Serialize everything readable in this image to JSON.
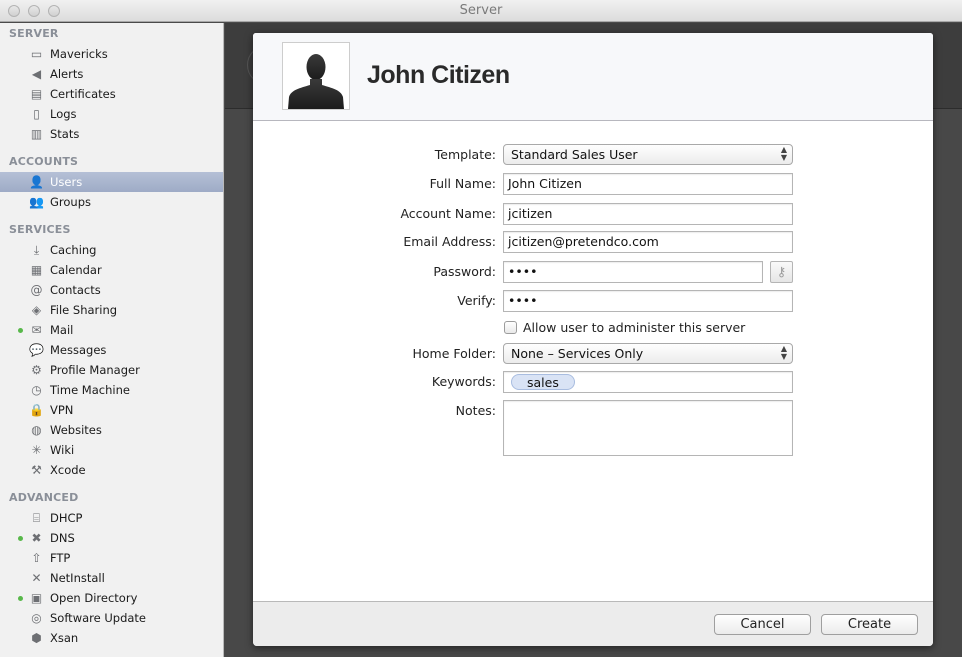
{
  "window": {
    "title": "Server"
  },
  "sidebar": {
    "sections": [
      {
        "header": "SERVER",
        "items": [
          {
            "label": "Mavericks",
            "icon": "monitor-icon",
            "glyph": "▭"
          },
          {
            "label": "Alerts",
            "icon": "megaphone-icon",
            "glyph": "◀"
          },
          {
            "label": "Certificates",
            "icon": "certificate-icon",
            "glyph": "▤"
          },
          {
            "label": "Logs",
            "icon": "document-icon",
            "glyph": "▯"
          },
          {
            "label": "Stats",
            "icon": "bar-chart-icon",
            "glyph": "▥"
          }
        ]
      },
      {
        "header": "ACCOUNTS",
        "items": [
          {
            "label": "Users",
            "icon": "user-icon",
            "glyph": "👤",
            "selected": true
          },
          {
            "label": "Groups",
            "icon": "group-icon",
            "glyph": "👥"
          }
        ]
      },
      {
        "header": "SERVICES",
        "items": [
          {
            "label": "Caching",
            "icon": "caching-icon",
            "glyph": "⤓"
          },
          {
            "label": "Calendar",
            "icon": "calendar-icon",
            "glyph": "▦"
          },
          {
            "label": "Contacts",
            "icon": "contacts-icon",
            "glyph": "@"
          },
          {
            "label": "File Sharing",
            "icon": "file-sharing-icon",
            "glyph": "◈"
          },
          {
            "label": "Mail",
            "icon": "mail-icon",
            "glyph": "✉",
            "status": "on"
          },
          {
            "label": "Messages",
            "icon": "messages-icon",
            "glyph": "💬"
          },
          {
            "label": "Profile Manager",
            "icon": "profile-manager-icon",
            "glyph": "⚙"
          },
          {
            "label": "Time Machine",
            "icon": "time-machine-icon",
            "glyph": "◷"
          },
          {
            "label": "VPN",
            "icon": "lock-icon",
            "glyph": "🔒"
          },
          {
            "label": "Websites",
            "icon": "globe-icon",
            "glyph": "◍"
          },
          {
            "label": "Wiki",
            "icon": "wiki-icon",
            "glyph": "✳"
          },
          {
            "label": "Xcode",
            "icon": "hammer-icon",
            "glyph": "⚒"
          }
        ]
      },
      {
        "header": "ADVANCED",
        "items": [
          {
            "label": "DHCP",
            "icon": "dhcp-icon",
            "glyph": "⌸"
          },
          {
            "label": "DNS",
            "icon": "dns-icon",
            "glyph": "✖",
            "status": "on"
          },
          {
            "label": "FTP",
            "icon": "ftp-icon",
            "glyph": "⇧"
          },
          {
            "label": "NetInstall",
            "icon": "netinstall-icon",
            "glyph": "✕"
          },
          {
            "label": "Open Directory",
            "icon": "open-directory-icon",
            "glyph": "▣",
            "status": "on"
          },
          {
            "label": "Software Update",
            "icon": "software-update-icon",
            "glyph": "◎"
          },
          {
            "label": "Xsan",
            "icon": "xsan-icon",
            "glyph": "⬢"
          }
        ]
      }
    ]
  },
  "sheet": {
    "user_name": "John Citizen",
    "form": {
      "template": {
        "label": "Template:",
        "value": "Standard Sales User"
      },
      "full_name": {
        "label": "Full Name:",
        "value": "John Citizen"
      },
      "account_name": {
        "label": "Account Name:",
        "value": "jcitizen"
      },
      "email": {
        "label": "Email Address:",
        "value": "jcitizen@pretendco.com"
      },
      "password": {
        "label": "Password:",
        "value": "••••"
      },
      "verify": {
        "label": "Verify:",
        "value": "••••"
      },
      "admin_checkbox": {
        "label": "Allow user to administer this server",
        "checked": false
      },
      "home_folder": {
        "label": "Home Folder:",
        "value": "None – Services Only"
      },
      "keywords": {
        "label": "Keywords:",
        "tokens": [
          "sales"
        ]
      },
      "notes": {
        "label": "Notes:",
        "value": ""
      }
    },
    "buttons": {
      "cancel": "Cancel",
      "create": "Create"
    }
  }
}
